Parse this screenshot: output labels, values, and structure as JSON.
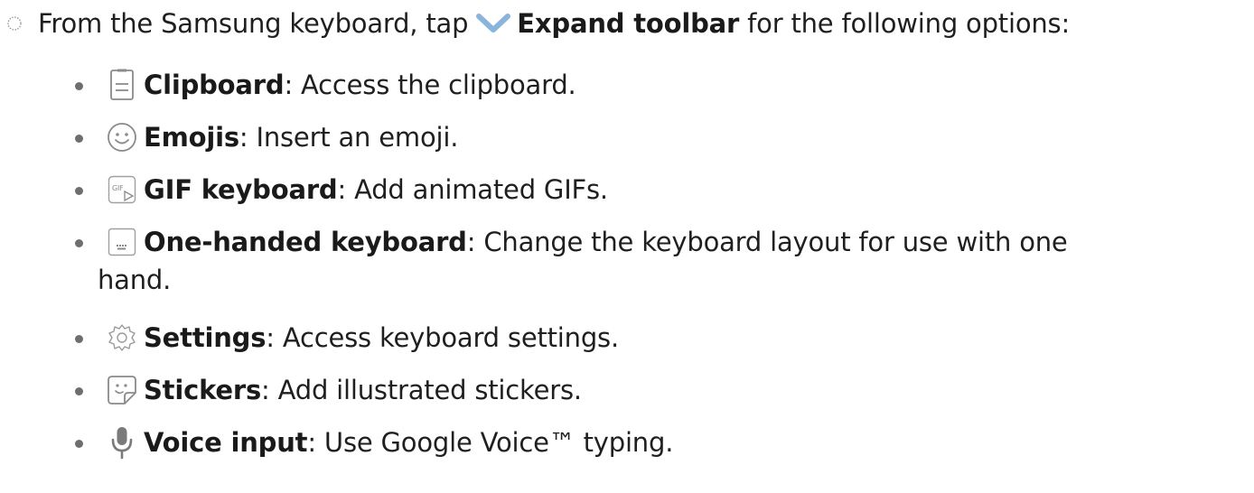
{
  "intro": {
    "prefix": "From the Samsung keyboard, tap",
    "action_label": "Expand toolbar",
    "suffix": "for the following options:",
    "bullet_icon": "dotted-circle-icon",
    "action_icon": "chevron-down-icon"
  },
  "options": [
    {
      "icon": "clipboard-icon",
      "label": "Clipboard",
      "desc": ": Access the clipboard."
    },
    {
      "icon": "emoji-icon",
      "label": "Emojis",
      "desc": ": Insert an emoji."
    },
    {
      "icon": "gif-keyboard-icon",
      "label": "GIF keyboard",
      "desc": ": Add animated GIFs."
    },
    {
      "icon": "one-handed-keyboard-icon",
      "label": "One-handed keyboard",
      "desc": ": Change the keyboard layout for use with one",
      "desc_cont": "hand."
    },
    {
      "icon": "gear-icon",
      "label": "Settings",
      "desc": ": Access keyboard settings."
    },
    {
      "icon": "sticker-icon",
      "label": "Stickers",
      "desc": ": Add illustrated stickers."
    },
    {
      "icon": "microphone-icon",
      "label": "Voice input",
      "desc": ": Use Google Voice™ typing."
    }
  ],
  "colors": {
    "text": "#1f1f1f",
    "icon": "#8a8a8a",
    "chevron": "#8ab4dc",
    "mic": "#7a7a7a"
  }
}
